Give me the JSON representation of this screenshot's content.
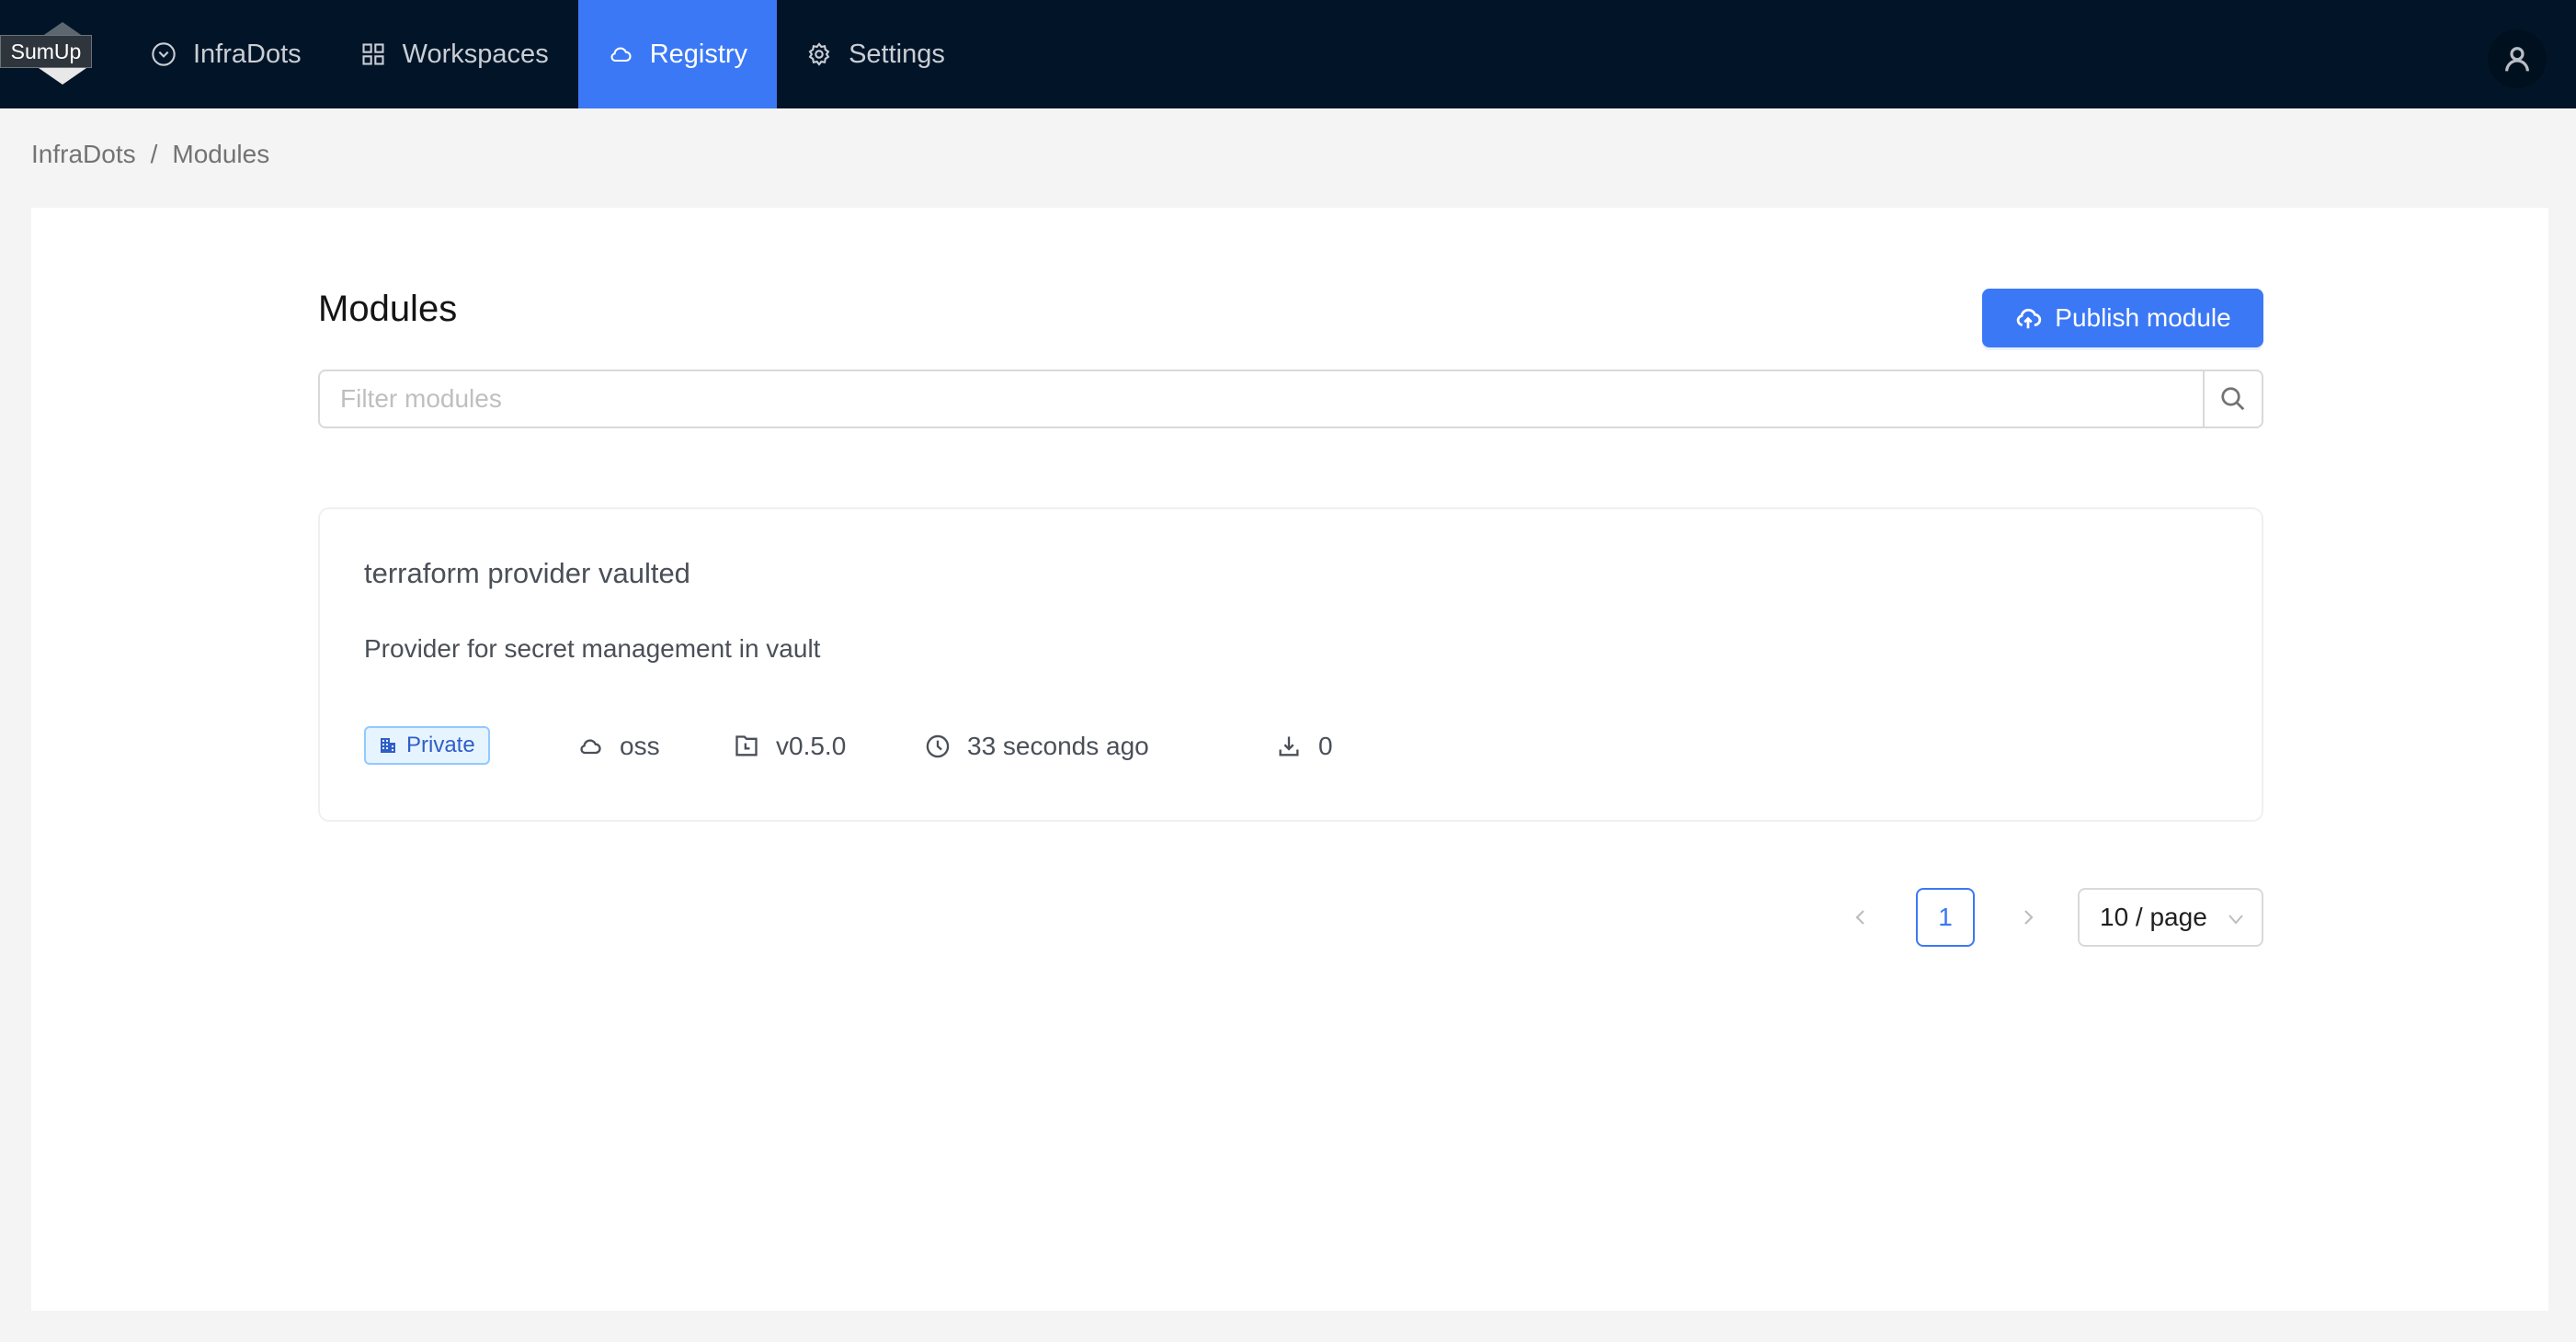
{
  "header": {
    "logo_text": "SumUp",
    "nav": [
      {
        "label": "InfraDots",
        "icon": "check-circle-icon",
        "active": false
      },
      {
        "label": "Workspaces",
        "icon": "grid-icon",
        "active": false
      },
      {
        "label": "Registry",
        "icon": "cloud-icon",
        "active": true
      },
      {
        "label": "Settings",
        "icon": "gear-icon",
        "active": false
      }
    ],
    "avatar_icon": "user-icon"
  },
  "breadcrumb": {
    "items": [
      "InfraDots",
      "Modules"
    ],
    "separator": "/"
  },
  "page": {
    "title": "Modules",
    "publish_button": "Publish module",
    "search": {
      "placeholder": "Filter modules",
      "value": ""
    }
  },
  "modules": [
    {
      "name": "terraform provider vaulted",
      "description": "Provider for secret management in vault",
      "visibility": "Private",
      "provider": "oss",
      "version": "v0.5.0",
      "updated": "33 seconds ago",
      "downloads": "0"
    }
  ],
  "pagination": {
    "current_page": "1",
    "page_size": "10 / page"
  },
  "colors": {
    "header_bg": "#021428",
    "accent": "#3b78f5",
    "tag_bg": "#e6f4ff",
    "tag_text": "#2f5ec8"
  }
}
